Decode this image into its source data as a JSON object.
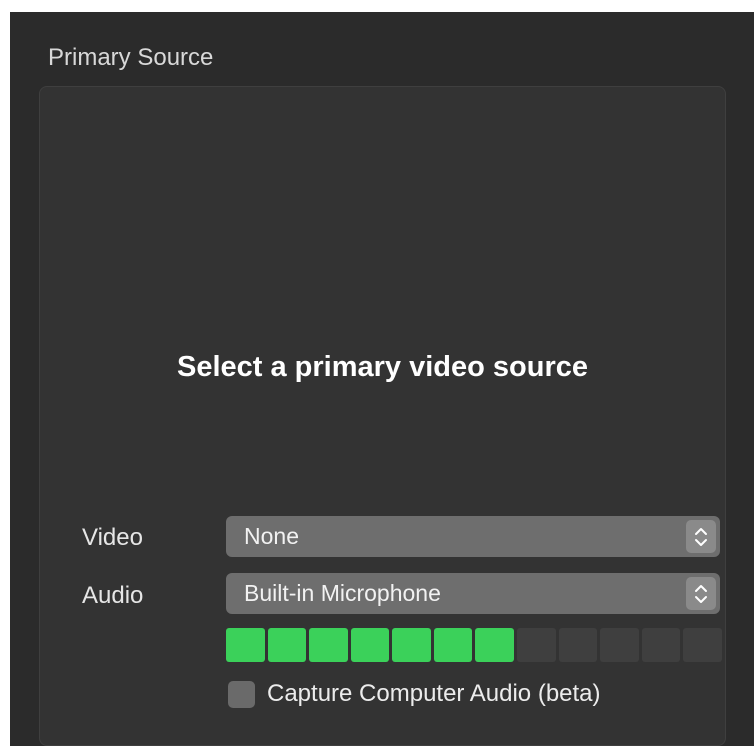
{
  "section": {
    "title": "Primary Source"
  },
  "preview": {
    "prompt": "Select a primary video source"
  },
  "video": {
    "label": "Video",
    "selected": "None"
  },
  "audio": {
    "label": "Audio",
    "selected": "Built-in Microphone"
  },
  "audio_meter": {
    "level": 0.7,
    "segments_total": 12,
    "segments_lit": 7,
    "lit_color": "#3bd15a"
  },
  "capture": {
    "label": "Capture Computer Audio (beta)",
    "checked": false
  },
  "icons": {
    "popup_stepper": "chevron-up-down-icon"
  }
}
